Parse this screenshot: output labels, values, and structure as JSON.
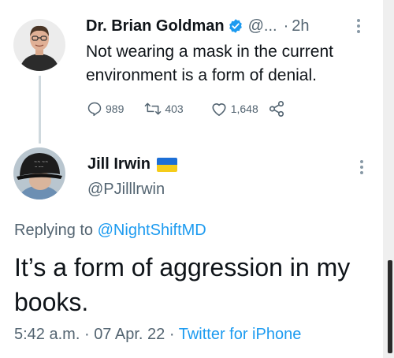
{
  "tweet_main": {
    "author_name": "Dr. Brian Goldman",
    "handle": "@...",
    "separator": "·",
    "time": "2h",
    "text": "Not wearing a mask in the current environment is a form of denial.",
    "verified": true,
    "replies": "989",
    "retweets": "403",
    "likes": "1,648"
  },
  "tweet_reply": {
    "author_name": "Jill Irwin",
    "handle": "@PJilllrwin",
    "flag": "Ukraine flag (blue/yellow)",
    "replying_label": "Replying to",
    "replying_to": "@NightShiftMD",
    "text": "It’s a form of aggression in my books.",
    "time": "5:42 a.m.",
    "sep1": "·",
    "date": "07 Apr. 22",
    "sep2": "·",
    "source": "Twitter for iPhone"
  },
  "icons": [
    "verified-badge-icon",
    "more-icon",
    "reply-icon",
    "retweet-icon",
    "like-icon",
    "share-icon"
  ],
  "colors": {
    "text": "#0f1419",
    "secondary": "#536471",
    "accent": "#1d9bf0",
    "line": "#cfd9de"
  }
}
